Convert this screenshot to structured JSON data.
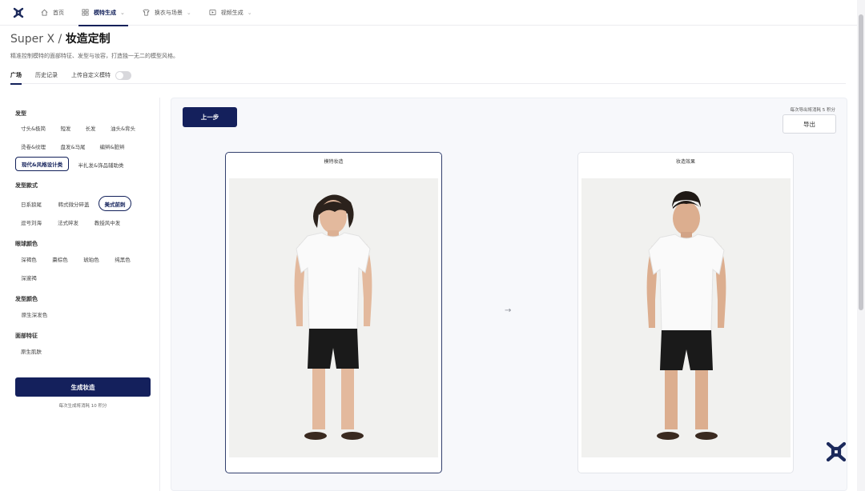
{
  "nav": {
    "items": [
      {
        "label": "首页",
        "icon": "home-icon"
      },
      {
        "label": "模特生成",
        "icon": "grid-icon",
        "active": true
      },
      {
        "label": "换衣与场景",
        "icon": "shirt-icon"
      },
      {
        "label": "视频生成",
        "icon": "video-icon"
      }
    ]
  },
  "header": {
    "brand": "Super X /",
    "title": "妆造定制",
    "subtitle": "精准控制模特的面部特征、发型与妆容，打造独一无二的模型风格。"
  },
  "tabs": {
    "plaza": "广场",
    "history": "历史记录",
    "upload_custom": "上传自定义模特"
  },
  "options": {
    "hairstyle": {
      "label": "发型",
      "chips": [
        "寸头&极简",
        "短发",
        "长发",
        "油头&背头",
        "烫卷&纹理",
        "盘发&马尾",
        "编辫&脏辫",
        "现代&风格设计类",
        "半扎发&饰品辅助类"
      ]
    },
    "style": {
      "label": "发型款式",
      "chips": [
        "日系狼尾",
        "韩式微分碎盖",
        "美式前刺",
        "逗号刘海",
        "法式碎发",
        "教授风中发"
      ]
    },
    "eye_color": {
      "label": "眼球颜色",
      "chips": [
        "深褐色",
        "棗棕色",
        "琥珀色",
        "纯黑色",
        "深邃褐"
      ]
    },
    "hair_color": {
      "label": "发型颜色",
      "chips": [
        "原生深发色"
      ]
    },
    "face": {
      "label": "面部特征",
      "chips": [
        "原生肌肤"
      ]
    }
  },
  "actions": {
    "generate": "生成妆造",
    "generate_cost": "每次生成将消耗 10 积分",
    "prev": "上一步",
    "export": "导出",
    "export_cost": "每次导出将消耗 5 积分"
  },
  "cards": {
    "before": "模特妆造",
    "after": "妆造效果"
  },
  "colors": {
    "primary": "#14205c",
    "panel_bg": "#f7f8fb"
  }
}
